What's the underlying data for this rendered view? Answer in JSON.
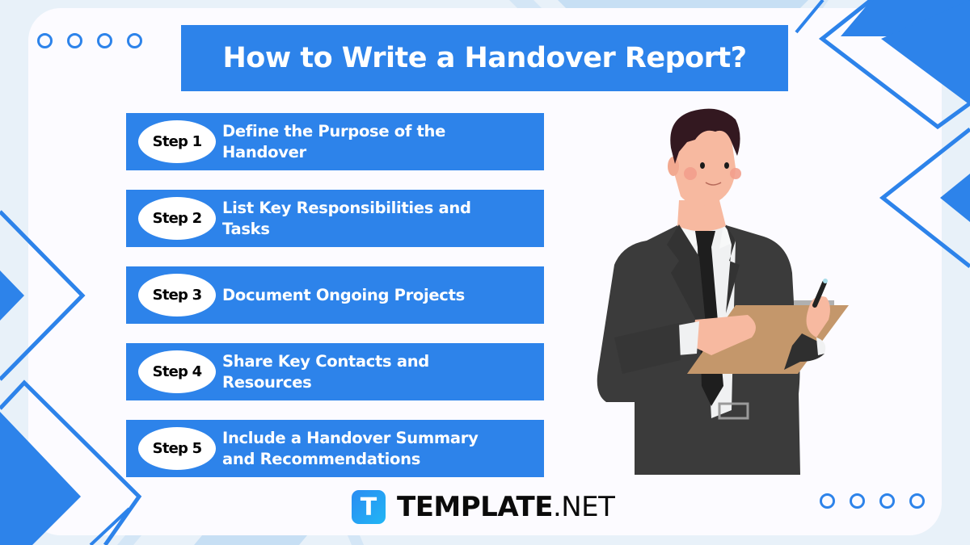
{
  "title": "How to Write a Handover Report?",
  "steps": [
    {
      "label": "Step 1",
      "text": "Define the Purpose of the Handover"
    },
    {
      "label": "Step 2",
      "text": "List Key Responsibilities and Tasks"
    },
    {
      "label": "Step 3",
      "text": "Document Ongoing Projects"
    },
    {
      "label": "Step 4",
      "text": "Share Key Contacts and Resources"
    },
    {
      "label": "Step 5",
      "text": "Include a Handover Summary and Recommendations"
    }
  ],
  "brand": {
    "icon_letter": "T",
    "name": "TEMPLATE",
    "tld": ".NET"
  },
  "illustration": "businessman-with-clipboard",
  "colors": {
    "accent": "#2d83ea",
    "background": "#e8f1f9",
    "card": "#fcfbff",
    "light_accent": "#c7dff4"
  }
}
